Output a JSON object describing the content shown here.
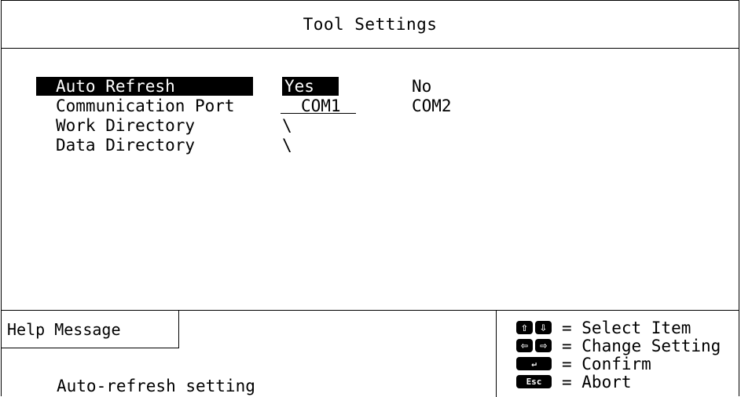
{
  "window": {
    "title": "Tool Settings"
  },
  "settings": [
    {
      "label": "Auto Refresh",
      "option1": "Yes",
      "option2": "No",
      "selected": true
    },
    {
      "label": "Communication Port",
      "option1": "COM1",
      "option2": "COM2",
      "selected": false
    },
    {
      "label": "Work Directory",
      "option1": "\\",
      "option2": "",
      "selected": false
    },
    {
      "label": "Data Directory",
      "option1": "\\",
      "option2": "",
      "selected": false
    }
  ],
  "help": {
    "header": "Help Message",
    "message": "Auto-refresh setting"
  },
  "keys": [
    {
      "icon": "up-down-arrow-keys-icon",
      "description": "= Select Item"
    },
    {
      "icon": "left-right-arrow-keys-icon",
      "description": "= Change Setting"
    },
    {
      "icon": "enter-key-icon",
      "description": "= Confirm"
    },
    {
      "icon": "esc-key-icon",
      "key_label": "Esc",
      "description": "= Abort"
    }
  ]
}
